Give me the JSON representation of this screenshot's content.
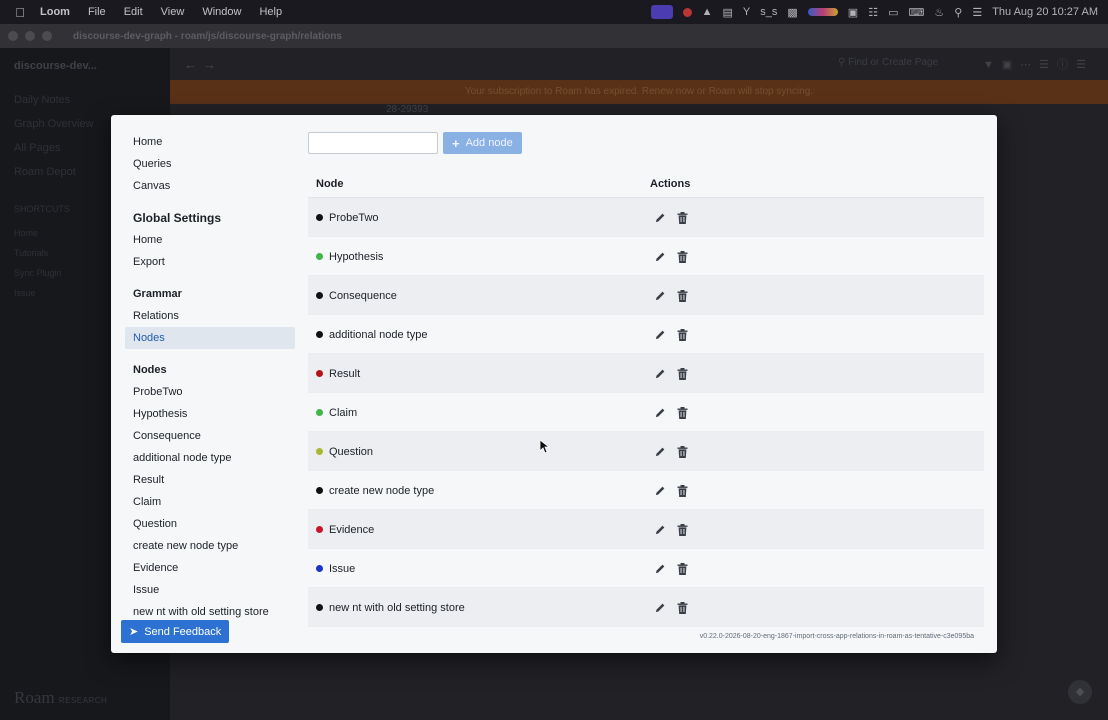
{
  "menubar": {
    "app_name": "Loom",
    "menus": [
      "File",
      "Edit",
      "View",
      "Window",
      "Help"
    ],
    "clock": "Thu Aug 20  10:27 AM",
    "tray_text": "s_s"
  },
  "window": {
    "title": "discourse-dev-graph - roam/js/discourse-graph/relations"
  },
  "roam": {
    "graph_name": "discourse-dev...",
    "sidebar_items": [
      "Daily Notes",
      "Graph Overview",
      "All Pages",
      "Roam Depot"
    ],
    "shortcuts_heading": "SHORTCUTS",
    "shortcuts": [
      "Home",
      "Tutorials",
      "Sync Plugin",
      "Issue"
    ],
    "search_placeholder": "Find or Create Page",
    "banner": "Your subscription to Roam has expired. Renew now or Roam will stop syncing.",
    "bg_text": "28-29393",
    "logo": "Roam",
    "logo_sub": "RESEARCH"
  },
  "dialog": {
    "nav": {
      "top_items": [
        "Home",
        "Queries",
        "Canvas"
      ],
      "global_heading": "Global Settings",
      "global_items": [
        "Home",
        "Export"
      ],
      "grammar_heading": "Grammar",
      "grammar_items": [
        "Relations",
        "Nodes"
      ],
      "nodes_heading": "Nodes",
      "node_items": [
        "ProbeTwo",
        "Hypothesis",
        "Consequence",
        "additional node type",
        "Result",
        "Claim",
        "Question",
        "create new node type",
        "Evidence",
        "Issue",
        "new nt with old setting store"
      ]
    },
    "send_feedback": "Send Feedback",
    "node_input_value": "",
    "add_node_label": "Add node",
    "table": {
      "headers": {
        "node": "Node",
        "actions": "Actions"
      },
      "rows": [
        {
          "name": "ProbeTwo",
          "color": "#111111"
        },
        {
          "name": "Hypothesis",
          "color": "#3fb54a"
        },
        {
          "name": "Consequence",
          "color": "#111111"
        },
        {
          "name": "additional node type",
          "color": "#111111"
        },
        {
          "name": "Result",
          "color": "#b5121b"
        },
        {
          "name": "Claim",
          "color": "#3fb54a"
        },
        {
          "name": "Question",
          "color": "#a8b832"
        },
        {
          "name": "create new node type",
          "color": "#111111"
        },
        {
          "name": "Evidence",
          "color": "#c9152c"
        },
        {
          "name": "Issue",
          "color": "#1a35c9"
        },
        {
          "name": "new nt with old setting store",
          "color": "#111111"
        }
      ]
    },
    "version": "v0.22.0-2026-08-20-eng-1867-import-cross-app-relations-in-roam-as-tentative-c3e095ba"
  },
  "colors": {
    "accent": "#2d72d2",
    "active_nav_bg": "#dfe6ee",
    "active_nav_text": "#215db0"
  }
}
